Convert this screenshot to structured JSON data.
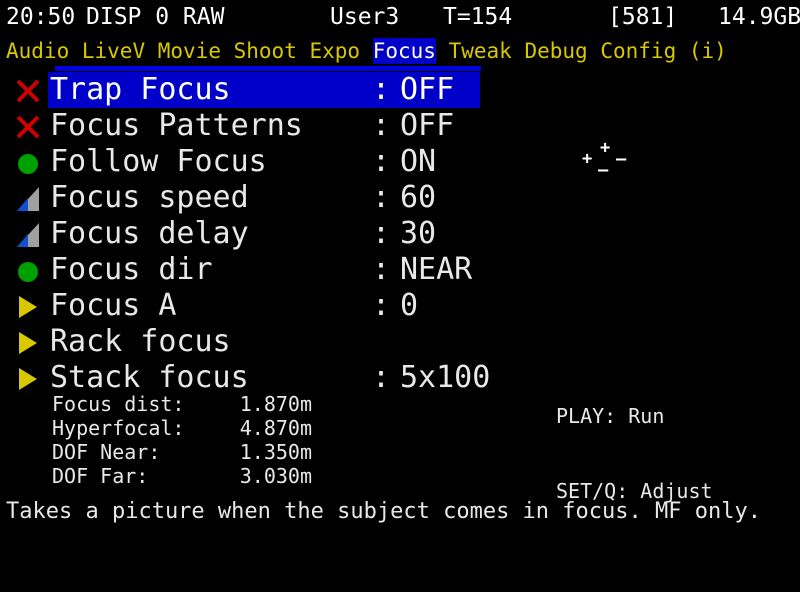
{
  "statusbar": {
    "time": "20:50",
    "display_mode": "DISP 0 RAW",
    "user_profile": "User3",
    "temperature": "T=154",
    "shots_remaining": "[581]",
    "card_space": "14.9GB"
  },
  "tabbar": {
    "tabs": [
      {
        "label": "Audio",
        "active": false
      },
      {
        "label": "LiveV",
        "active": false
      },
      {
        "label": "Movie",
        "active": false
      },
      {
        "label": "Shoot",
        "active": false
      },
      {
        "label": "Expo",
        "active": false
      },
      {
        "label": "Focus",
        "active": true
      },
      {
        "label": "Tweak",
        "active": false
      },
      {
        "label": "Debug",
        "active": false
      },
      {
        "label": "Config",
        "active": false
      },
      {
        "label": "(i)",
        "active": false
      }
    ],
    "active_tab": "Focus"
  },
  "menu": {
    "rows": [
      {
        "icon": "cross-icon",
        "label": "Trap Focus",
        "colon": ":",
        "value": "OFF",
        "selected": true
      },
      {
        "icon": "cross-icon",
        "label": "Focus Patterns",
        "colon": ":",
        "value": "OFF",
        "selected": false
      },
      {
        "icon": "dot-icon",
        "label": "Follow Focus",
        "colon": ":",
        "value": "ON",
        "selected": false
      },
      {
        "icon": "slider-icon",
        "label": "Focus speed",
        "colon": ":",
        "value": "60",
        "selected": false
      },
      {
        "icon": "slider-icon",
        "label": "Focus delay",
        "colon": ":",
        "value": "30",
        "selected": false
      },
      {
        "icon": "dot-icon",
        "label": "Focus dir",
        "colon": ":",
        "value": "NEAR",
        "selected": false
      },
      {
        "icon": "arrow-icon",
        "label": "Focus A",
        "colon": ":",
        "value": "0",
        "selected": false
      },
      {
        "icon": "arrow-icon",
        "label": "Rack focus",
        "colon": "",
        "value": "",
        "selected": false
      },
      {
        "icon": "arrow-icon",
        "label": "Stack focus",
        "colon": ":",
        "value": "5x100",
        "selected": false
      }
    ]
  },
  "adjust_widget": {
    "plus_top": "+",
    "plus_left": "+",
    "minus_right": "–",
    "minus_bottom": "–"
  },
  "hints": {
    "play": "PLAY: Run",
    "setq": "SET/Q: Adjust"
  },
  "info": {
    "rows": [
      {
        "key": "Focus dist:",
        "value": "1.870m"
      },
      {
        "key": "Hyperfocal:",
        "value": "4.870m"
      },
      {
        "key": "DOF Near:",
        "value": "1.350m"
      },
      {
        "key": "DOF Far:",
        "value": "3.030m"
      }
    ]
  },
  "footer": {
    "help": "Takes a picture when the subject comes in focus. MF only."
  },
  "colors": {
    "background": "#000000",
    "text": "#e8e8e8",
    "tab_text": "#d8c800",
    "highlight_bg": "#0000c8",
    "underline": "#0000e0",
    "icon_cross": "#d00000",
    "icon_dot": "#00a000",
    "icon_arrow": "#d8c800",
    "icon_slider_track": "#a0a0a0",
    "icon_slider_fill": "#1050d0"
  }
}
